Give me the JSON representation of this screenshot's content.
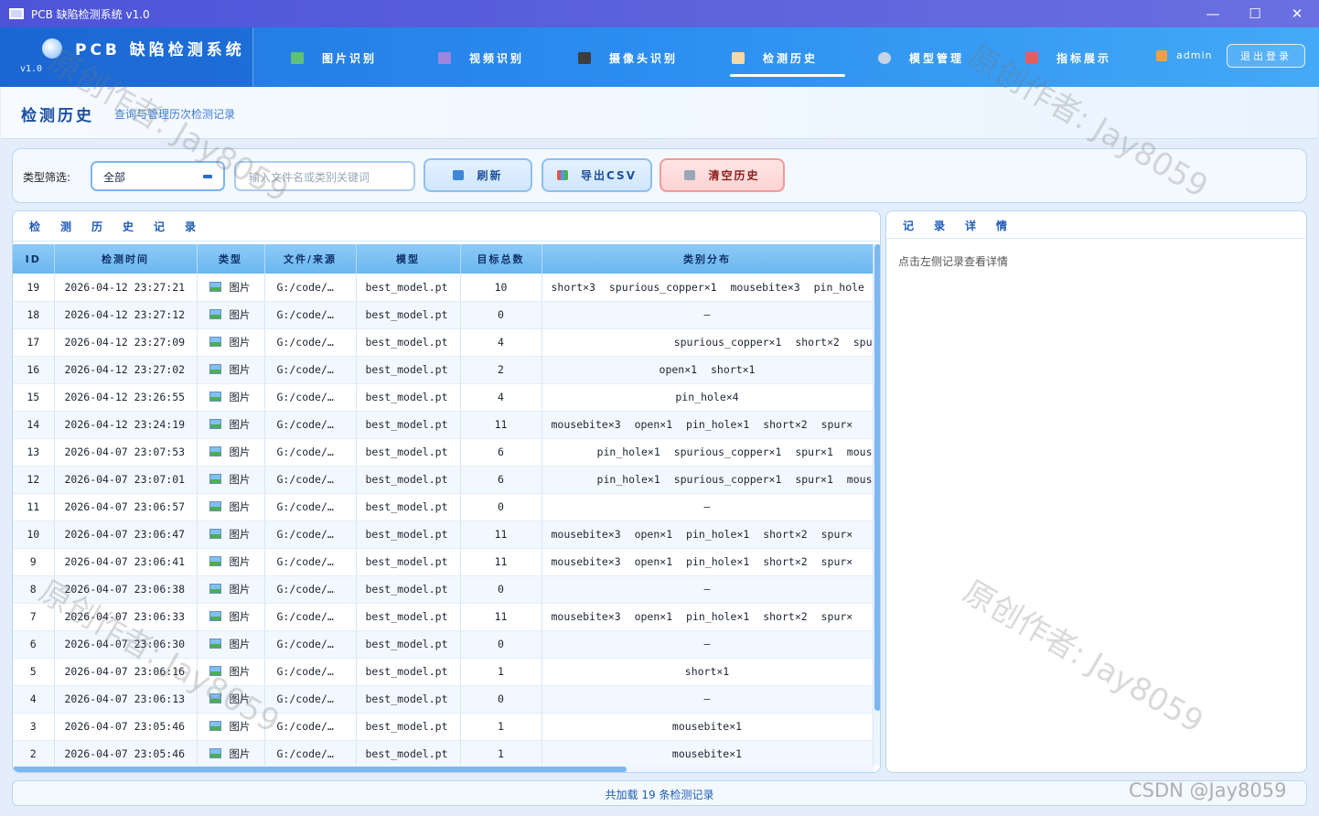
{
  "window": {
    "title": "PCB 缺陷检测系统 v1.0",
    "min": "—",
    "max": "☐",
    "close": "✕"
  },
  "brand": {
    "name": "PCB 缺陷检测系统",
    "version": "v1.0"
  },
  "nav": {
    "items": [
      {
        "label": "图片识别",
        "icon": "image-icon",
        "color": "#5fc07a"
      },
      {
        "label": "视频识别",
        "icon": "video-icon",
        "color": "#a085e0"
      },
      {
        "label": "摄像头识别",
        "icon": "camera-icon",
        "color": "#3d3d3d"
      },
      {
        "label": "检测历史",
        "icon": "clipboard-icon",
        "color": "#f3d9a8"
      },
      {
        "label": "模型管理",
        "icon": "gear-icon",
        "color": "#c7d3e6"
      },
      {
        "label": "指标展示",
        "icon": "chart-icon",
        "color": "#e06060"
      }
    ],
    "active": "检测历史",
    "user": "admin",
    "logout": "退出登录"
  },
  "page": {
    "title": "检测历史",
    "subtitle": "查询与管理历次检测记录"
  },
  "toolbar": {
    "filter_label": "类型筛选:",
    "filter_value": "全部",
    "search_placeholder": "输入文件名或类别关键词",
    "refresh": "刷新",
    "export": "导出CSV",
    "clear": "清空历史"
  },
  "records_panel": {
    "title": "检测历史记录"
  },
  "table": {
    "columns": [
      "ID",
      "检测时间",
      "类型",
      "文件/来源",
      "模型",
      "目标总数",
      "类别分布"
    ],
    "rows": [
      {
        "id": "19",
        "time": "2026-04-12 23:27:21",
        "type": "图片",
        "file": "G:/code/…",
        "model": "best_model.pt",
        "count": "10",
        "dist": "short×3 spurious_copper×1 mousebite×3 pin_hole",
        "align": "left"
      },
      {
        "id": "18",
        "time": "2026-04-12 23:27:12",
        "type": "图片",
        "file": "G:/code/…",
        "model": "best_model.pt",
        "count": "0",
        "dist": "—",
        "align": "center"
      },
      {
        "id": "17",
        "time": "2026-04-12 23:27:09",
        "type": "图片",
        "file": "G:/code/…",
        "model": "best_model.pt",
        "count": "4",
        "dist": "spurious_copper×1 short×2 spu",
        "align": "right"
      },
      {
        "id": "16",
        "time": "2026-04-12 23:27:02",
        "type": "图片",
        "file": "G:/code/…",
        "model": "best_model.pt",
        "count": "2",
        "dist": "open×1 short×1",
        "align": "center"
      },
      {
        "id": "15",
        "time": "2026-04-12 23:26:55",
        "type": "图片",
        "file": "G:/code/…",
        "model": "best_model.pt",
        "count": "4",
        "dist": "pin_hole×4",
        "align": "center"
      },
      {
        "id": "14",
        "time": "2026-04-12 23:24:19",
        "type": "图片",
        "file": "G:/code/…",
        "model": "best_model.pt",
        "count": "11",
        "dist": "mousebite×3 open×1 pin_hole×1 short×2 spur×",
        "align": "left"
      },
      {
        "id": "13",
        "time": "2026-04-07 23:07:53",
        "type": "图片",
        "file": "G:/code/…",
        "model": "best_model.pt",
        "count": "6",
        "dist": "pin_hole×1 spurious_copper×1 spur×1 mous",
        "align": "right"
      },
      {
        "id": "12",
        "time": "2026-04-07 23:07:01",
        "type": "图片",
        "file": "G:/code/…",
        "model": "best_model.pt",
        "count": "6",
        "dist": "pin_hole×1 spurious_copper×1 spur×1 mous",
        "align": "right"
      },
      {
        "id": "11",
        "time": "2026-04-07 23:06:57",
        "type": "图片",
        "file": "G:/code/…",
        "model": "best_model.pt",
        "count": "0",
        "dist": "—",
        "align": "center"
      },
      {
        "id": "10",
        "time": "2026-04-07 23:06:47",
        "type": "图片",
        "file": "G:/code/…",
        "model": "best_model.pt",
        "count": "11",
        "dist": "mousebite×3 open×1 pin_hole×1 short×2 spur×",
        "align": "left"
      },
      {
        "id": "9",
        "time": "2026-04-07 23:06:41",
        "type": "图片",
        "file": "G:/code/…",
        "model": "best_model.pt",
        "count": "11",
        "dist": "mousebite×3 open×1 pin_hole×1 short×2 spur×",
        "align": "left"
      },
      {
        "id": "8",
        "time": "2026-04-07 23:06:38",
        "type": "图片",
        "file": "G:/code/…",
        "model": "best_model.pt",
        "count": "0",
        "dist": "—",
        "align": "center"
      },
      {
        "id": "7",
        "time": "2026-04-07 23:06:33",
        "type": "图片",
        "file": "G:/code/…",
        "model": "best_model.pt",
        "count": "11",
        "dist": "mousebite×3 open×1 pin_hole×1 short×2 spur×",
        "align": "left"
      },
      {
        "id": "6",
        "time": "2026-04-07 23:06:30",
        "type": "图片",
        "file": "G:/code/…",
        "model": "best_model.pt",
        "count": "0",
        "dist": "—",
        "align": "center"
      },
      {
        "id": "5",
        "time": "2026-04-07 23:06:16",
        "type": "图片",
        "file": "G:/code/…",
        "model": "best_model.pt",
        "count": "1",
        "dist": "short×1",
        "align": "center"
      },
      {
        "id": "4",
        "time": "2026-04-07 23:06:13",
        "type": "图片",
        "file": "G:/code/…",
        "model": "best_model.pt",
        "count": "0",
        "dist": "—",
        "align": "center"
      },
      {
        "id": "3",
        "time": "2026-04-07 23:05:46",
        "type": "图片",
        "file": "G:/code/…",
        "model": "best_model.pt",
        "count": "1",
        "dist": "mousebite×1",
        "align": "center"
      },
      {
        "id": "2",
        "time": "2026-04-07 23:05:46",
        "type": "图片",
        "file": "G:/code/…",
        "model": "best_model.pt",
        "count": "1",
        "dist": "mousebite×1",
        "align": "center"
      }
    ]
  },
  "detail_panel": {
    "title": "记录详情",
    "hint": "点击左侧记录查看详情"
  },
  "footer": {
    "status": "共加载 19 条检测记录"
  },
  "watermark": {
    "text": "原创作者: Jay8059",
    "corner": "CSDN @Jay8059"
  }
}
